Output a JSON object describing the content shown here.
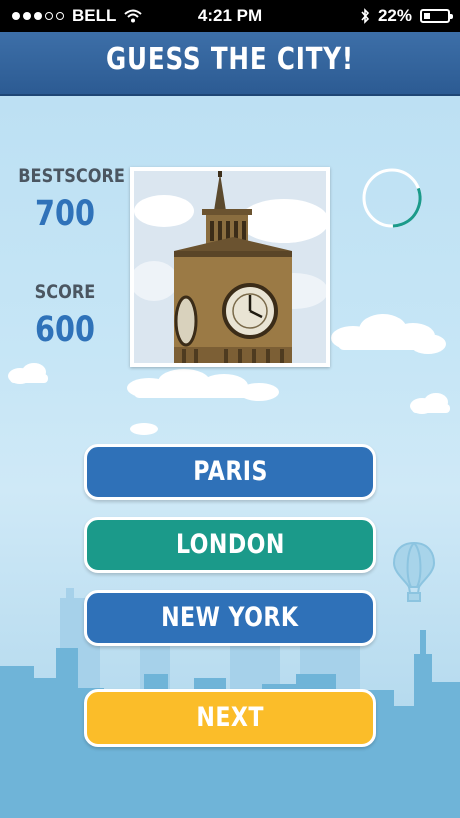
{
  "status_bar": {
    "carrier": "BELL",
    "time": "4:21 PM",
    "battery": "22%"
  },
  "header": {
    "title": "GUESS THE CITY!"
  },
  "scores": {
    "best_label": "BESTSCORE",
    "best_value": "700",
    "score_label": "SCORE",
    "score_value": "600"
  },
  "timer": {
    "progress_fraction": 0.3
  },
  "answers": [
    {
      "label": "PARIS",
      "color": "#2f71b8"
    },
    {
      "label": "LONDON",
      "color": "#1b9a8a"
    },
    {
      "label": "NEW YORK",
      "color": "#2f71b8"
    }
  ],
  "next_button": {
    "label": "NEXT",
    "color": "#fbbd29"
  },
  "photo": {
    "subject": "big-ben-clock-tower"
  },
  "colors": {
    "header": "#2c5b93",
    "score_value": "#2f72b9",
    "sky": "#c7e6f6",
    "skyline": "#6fb4d8"
  }
}
